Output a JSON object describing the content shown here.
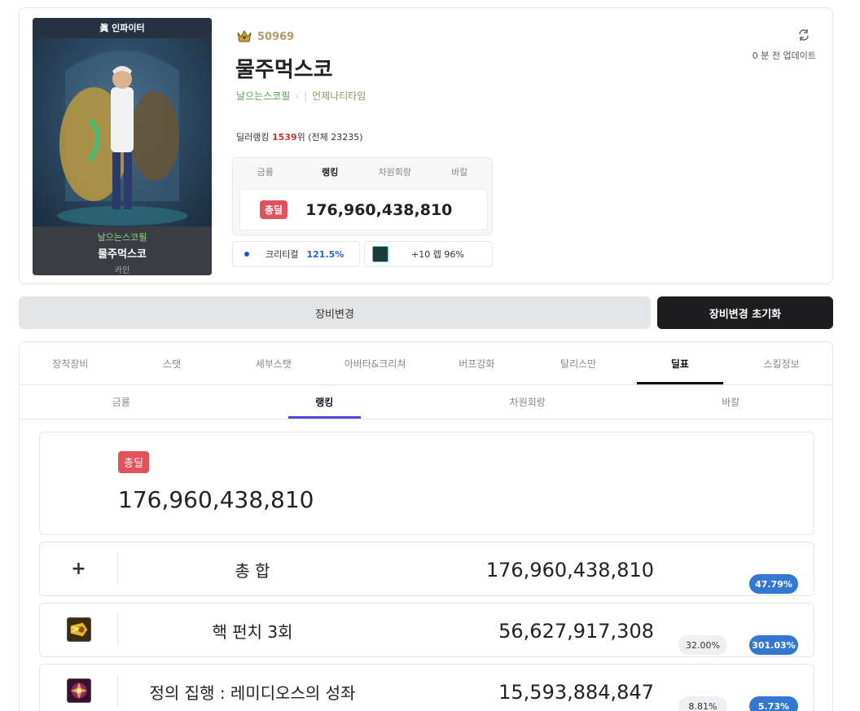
{
  "profile": {
    "server": "眞 인파이터",
    "adventure_name": "날으는스코필",
    "character_name": "물주먹스코",
    "server_tag": "카인",
    "fame_value": "50969",
    "guild": "언제나티타임",
    "update_text": "0 분 전 업데이트",
    "dealer_rank_label": "딜러랭킹 ",
    "dealer_rank_value": "1539",
    "dealer_rank_suffix": "위 (전체 23235)",
    "mini_tabs": [
      "금룡",
      "랭킹",
      "차원회랑",
      "바칼"
    ],
    "mini_badge": "총딜",
    "mini_total": "176,960,438,810",
    "crit_label": "크리티컬",
    "crit_value": "121.5%",
    "enchant_text": "+10 렙 96%"
  },
  "buttons": {
    "change": "장비변경",
    "reset": "장비변경 초기화"
  },
  "main_tabs": [
    "장착장비",
    "스탯",
    "세부스탯",
    "아바타&크리쳐",
    "버프강화",
    "탈리스만",
    "딜표",
    "스킬정보"
  ],
  "sub_tabs": [
    "금룡",
    "랭킹",
    "차원회랑",
    "바칼"
  ],
  "summary": {
    "badge": "총딜",
    "total": "176,960,438,810"
  },
  "rows": [
    {
      "icon": "plus-icon",
      "name": "총 합",
      "damage": "176,960,438,810",
      "share": "",
      "ratio": "47.79%"
    },
    {
      "icon": "hook-punch-skill-icon",
      "name": "핵 펀치 3회",
      "damage": "56,627,917,308",
      "share": "32.00%",
      "ratio": "301.03%"
    },
    {
      "icon": "justice-execution-skill-icon",
      "name": "정의 집행 : 레미디오스의 성좌",
      "damage": "15,593,884,847",
      "share": "8.81%",
      "ratio": "5.73%"
    }
  ],
  "colors": {
    "badge_red": "#e0525c",
    "pct_blue": "#3377d1",
    "sub_tab_underline": "#5148d6",
    "reset_button": "#1d1d1f",
    "fame_gold": "#b09a6a",
    "adventure_green": "#5ba05a"
  }
}
